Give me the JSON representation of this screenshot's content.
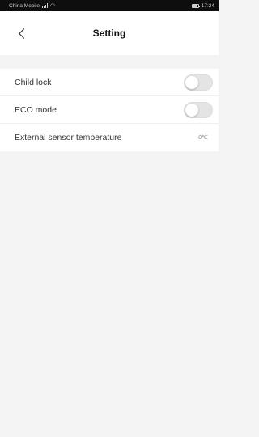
{
  "status_bar": {
    "carrier": "China Mobile",
    "time": "17:24",
    "battery_level": 0.75
  },
  "header": {
    "title": "Setting",
    "back_icon": "chevron-left-icon"
  },
  "settings": [
    {
      "label": "Child lock",
      "type": "toggle",
      "enabled": false
    },
    {
      "label": "ECO mode",
      "type": "toggle",
      "enabled": false
    },
    {
      "label": "External sensor temperature",
      "type": "value",
      "value": "0℃"
    }
  ],
  "colors": {
    "statusbar_bg": "#0e0e0e",
    "navbar_bg": "#ffffff",
    "page_bg": "#f4f4f4",
    "toggle_off": "#e4e4e4"
  }
}
